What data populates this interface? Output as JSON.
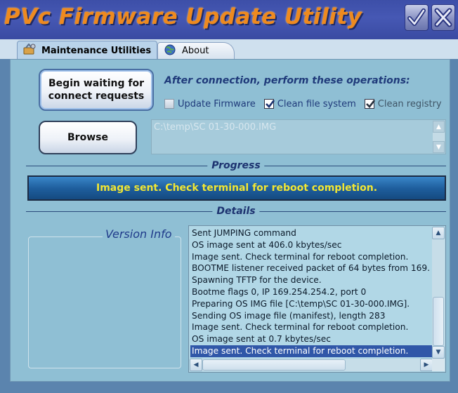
{
  "window": {
    "title": "PVc Firmware Update Utility",
    "accent_title_color": "#ee8a1f",
    "titlebar_color": "#4658b4",
    "buttons": {
      "check": "check-icon",
      "close": "close-icon"
    }
  },
  "tabs": [
    {
      "label": "Maintenance Utilities",
      "icon": "tools-icon",
      "active": true
    },
    {
      "label": "About",
      "icon": "globe-icon",
      "active": false
    }
  ],
  "actions": {
    "wait_button": "Begin waiting for connect requests",
    "browse_button": "Browse"
  },
  "operations": {
    "heading": "After connection, perform these operations:",
    "options": [
      {
        "label": "Update Firmware",
        "checked": false
      },
      {
        "label": "Clean file system",
        "checked": true
      },
      {
        "label": "Clean registry",
        "checked": true
      }
    ]
  },
  "file_path": "C:\\temp\\SC 01-30-000.IMG",
  "progress": {
    "section_label": "Progress",
    "status_text": "Image sent. Check terminal for reboot completion.",
    "status_color": "#f2e733",
    "fill_fraction": 1.0
  },
  "details": {
    "section_label": "Details",
    "version_info_title": "Version Info",
    "log_lines": [
      "Sent JUMPING command",
      "OS image sent at 406.0 kbytes/sec",
      "Image sent. Check terminal for reboot completion.",
      "BOOTME listener received packet of 64 bytes from 169.",
      "Spawning TFTP for the device.",
      "Bootme flags 0, IP 169.254.254.2, port 0",
      "Preparing OS IMG file [C:\\temp\\SC 01-30-000.IMG].",
      "Sending OS image file (manifest), length 283",
      "Image sent. Check terminal for reboot completion.",
      "OS image sent at 0.7 kbytes/sec",
      "Image sent. Check terminal for reboot completion."
    ],
    "selected_line_index": 10,
    "selection_color": "#3057a8"
  }
}
